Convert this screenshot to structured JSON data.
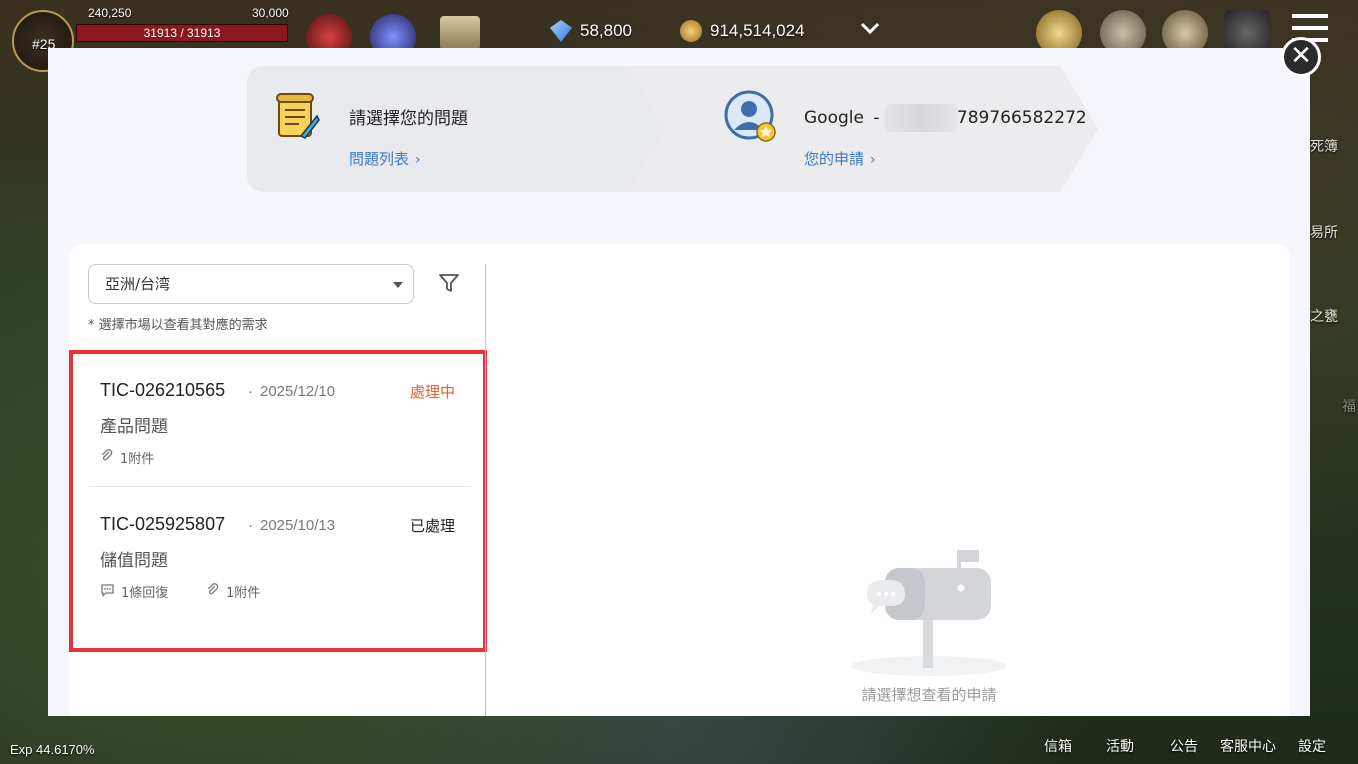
{
  "hud": {
    "level": "25",
    "attack": "240,250",
    "defense": "30,000",
    "hp": "31913 / 31913",
    "diamonds": "58,800",
    "gold": "914,514,024",
    "exp": "Exp 44.6170%"
  },
  "right_menu": {
    "item1": "死簿",
    "item2": "易所",
    "item3": "之甕",
    "item4": "福"
  },
  "bottom_menu": [
    "信箱",
    "活動",
    "公告",
    "客服中心",
    "設定"
  ],
  "steps": {
    "step1_title": "請選擇您的問題",
    "step1_link": "問題列表",
    "step2_prefix": "Google",
    "step2_separator": "-",
    "step2_account_suffix": "789766582272",
    "step2_link": "您的申請",
    "chevron": "›"
  },
  "close_symbol": "✕",
  "market": {
    "selected": "亞洲/台湾",
    "hint": "* 選擇市場以查看其對應的需求"
  },
  "tickets": [
    {
      "id": "TIC-026210565",
      "separator": "·",
      "date": "2025/12/10",
      "status": "處理中",
      "category": "產品問題",
      "attachments": "1附件"
    },
    {
      "id": "TIC-025925807",
      "separator": "·",
      "date": "2025/10/13",
      "status": "已處理",
      "category": "儲值問題",
      "replies": "1條回復",
      "attachments": "1附件"
    }
  ],
  "empty_state": {
    "text": "請選擇想查看的申請"
  },
  "colors": {
    "accent_link": "#3e78c8",
    "status_processing": "#e8612c",
    "status_done": "#222222",
    "highlight_border": "#e8323a"
  }
}
